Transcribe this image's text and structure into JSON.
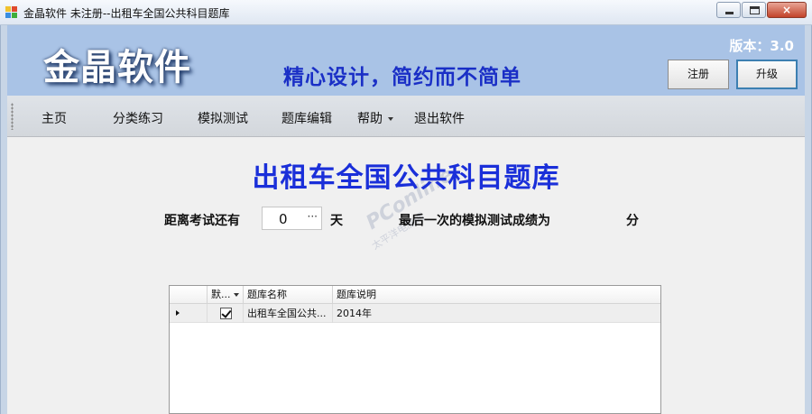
{
  "window": {
    "title": "金晶软件 未注册--出租车全国公共科目题库",
    "buttons": {
      "minimize": "minimize",
      "maximize": "maximize",
      "close": "×"
    }
  },
  "banner": {
    "logo": "金晶软件",
    "slogan": "精心设计，简约而不简单",
    "version": "版本：3.0",
    "register_label": "注册",
    "upgrade_label": "升级"
  },
  "menu": {
    "items": [
      {
        "label": "主页"
      },
      {
        "label": "分类练习"
      },
      {
        "label": "模拟测试"
      },
      {
        "label": "题库编辑"
      },
      {
        "label": "帮助"
      },
      {
        "label": "退出软件"
      }
    ]
  },
  "main": {
    "heading": "出租车全国公共科目题库",
    "days_label": "距离考试还有",
    "days_value": "0",
    "days_ellipsis": "···",
    "days_unit": "天",
    "score_label": "最后一次的模拟测试成绩为",
    "score_unit": "分"
  },
  "grid": {
    "columns": [
      "默...",
      "题库名称",
      "题库说明"
    ],
    "rows": [
      {
        "checked": true,
        "name": "出租车全国公共...",
        "desc": "2014年"
      }
    ]
  },
  "watermark": {
    "text": "PConline",
    "sub": "太平洋电脑网"
  },
  "colors": {
    "heading": "#1a2fd9",
    "slogan": "#1a2fc6",
    "banner": "#a9c3e6"
  }
}
